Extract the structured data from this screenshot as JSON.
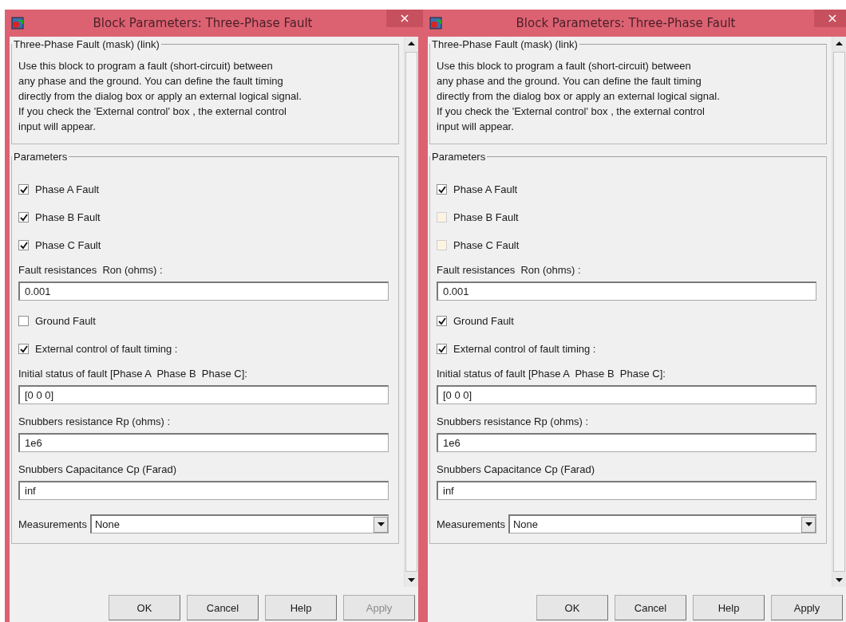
{
  "windows": [
    {
      "title": "Block Parameters: Three-Phase Fault",
      "close_label": "×",
      "description": {
        "legend": "Three-Phase Fault (mask) (link)",
        "text": "Use this block to program a fault (short-circuit) between\nany phase and the ground. You can define the fault timing\ndirectly from the dialog box or apply an external logical signal.\nIf you check the 'External control' box , the external control\ninput will appear."
      },
      "parameters": {
        "legend": "Parameters",
        "items": [
          {
            "kind": "checkbox",
            "label": "Phase A Fault",
            "checked": true,
            "disabled": false
          },
          {
            "kind": "checkbox",
            "label": "Phase B Fault",
            "checked": true,
            "disabled": false
          },
          {
            "kind": "checkbox",
            "label": "Phase C Fault",
            "checked": true,
            "disabled": false
          },
          {
            "kind": "field",
            "label": "Fault resistances  Ron (ohms) :",
            "value": "0.001"
          },
          {
            "kind": "checkbox",
            "label": "Ground Fault",
            "checked": false,
            "disabled": false
          },
          {
            "kind": "checkbox",
            "label": "External control of fault timing :",
            "checked": true,
            "disabled": false
          },
          {
            "kind": "field",
            "label": "Initial status of fault [Phase A  Phase B  Phase C]:",
            "value": "[0 0 0]"
          },
          {
            "kind": "field",
            "label": "Snubbers resistance Rp (ohms) :",
            "value": "1e6"
          },
          {
            "kind": "field",
            "label": "Snubbers Capacitance Cp (Farad)",
            "value": "inf"
          },
          {
            "kind": "dropdown",
            "label": "Measurements",
            "value": "None"
          }
        ]
      },
      "buttons": [
        {
          "label": "OK",
          "disabled": false
        },
        {
          "label": "Cancel",
          "disabled": false
        },
        {
          "label": "Help",
          "disabled": false
        },
        {
          "label": "Apply",
          "disabled": true
        }
      ]
    },
    {
      "title": "Block Parameters: Three-Phase Fault",
      "close_label": "×",
      "description": {
        "legend": "Three-Phase Fault (mask) (link)",
        "text": "Use this block to program a fault (short-circuit) between\nany phase and the ground. You can define the fault timing\ndirectly from the dialog box or apply an external logical signal.\nIf you check the 'External control' box , the external control\ninput will appear."
      },
      "parameters": {
        "legend": "Parameters",
        "items": [
          {
            "kind": "checkbox",
            "label": "Phase A Fault",
            "checked": true,
            "disabled": false
          },
          {
            "kind": "checkbox",
            "label": "Phase B Fault",
            "checked": false,
            "disabled": true
          },
          {
            "kind": "checkbox",
            "label": "Phase C Fault",
            "checked": false,
            "disabled": true
          },
          {
            "kind": "field",
            "label": "Fault resistances  Ron (ohms) :",
            "value": "0.001"
          },
          {
            "kind": "checkbox",
            "label": "Ground Fault",
            "checked": true,
            "disabled": false
          },
          {
            "kind": "checkbox",
            "label": "External control of fault timing :",
            "checked": true,
            "disabled": false
          },
          {
            "kind": "field",
            "label": "Initial status of fault [Phase A  Phase B  Phase C]:",
            "value": "[0 0 0]"
          },
          {
            "kind": "field",
            "label": "Snubbers resistance Rp (ohms) :",
            "value": "1e6"
          },
          {
            "kind": "field",
            "label": "Snubbers Capacitance Cp (Farad)",
            "value": "inf"
          },
          {
            "kind": "dropdown",
            "label": "Measurements",
            "value": "None"
          }
        ]
      },
      "buttons": [
        {
          "label": "OK",
          "disabled": false
        },
        {
          "label": "Cancel",
          "disabled": false
        },
        {
          "label": "Help",
          "disabled": false
        },
        {
          "label": "Apply",
          "disabled": false
        }
      ]
    }
  ]
}
